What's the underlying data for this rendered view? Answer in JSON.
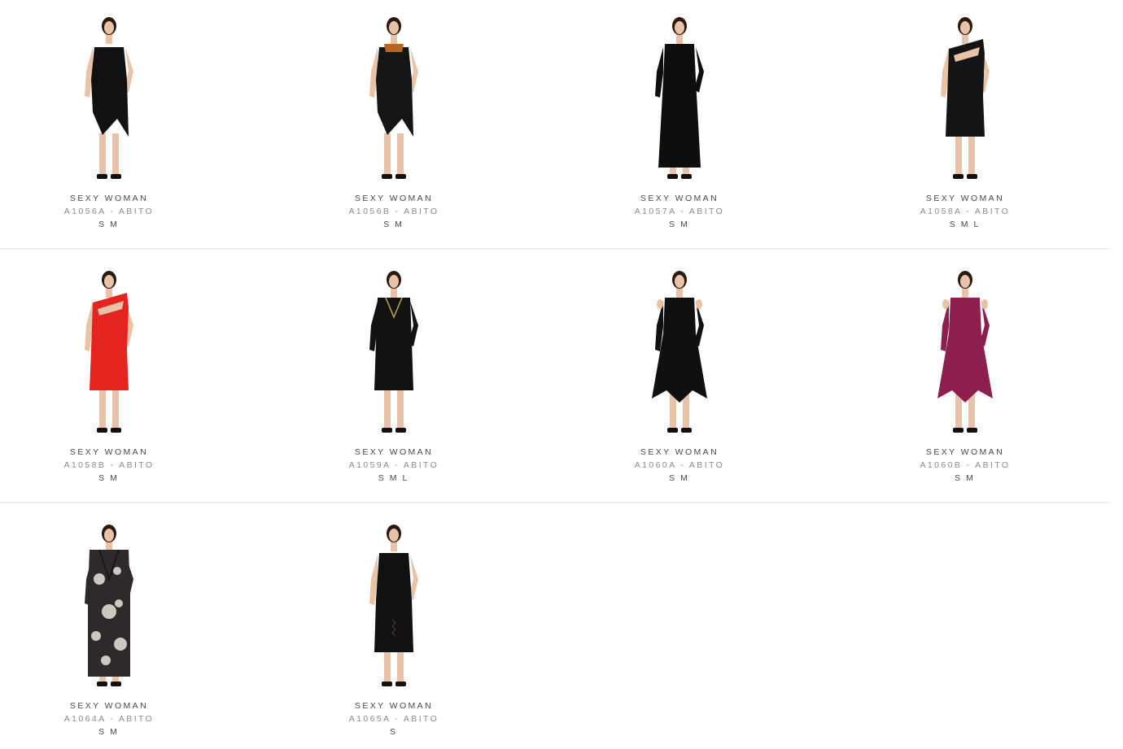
{
  "products": [
    {
      "brand": "SEXY WOMAN",
      "code": "A1056A - ABITO",
      "sizes": [
        "S",
        "M"
      ],
      "dress_color": "#111111",
      "accent": "#111111",
      "style": "asym-short"
    },
    {
      "brand": "SEXY WOMAN",
      "code": "A1056B - ABITO",
      "sizes": [
        "S",
        "M"
      ],
      "dress_color": "#151515",
      "accent": "#b8661f",
      "style": "asym-short"
    },
    {
      "brand": "SEXY WOMAN",
      "code": "A1057A - ABITO",
      "sizes": [
        "S",
        "M"
      ],
      "dress_color": "#0e0e0e",
      "accent": "#0e0e0e",
      "style": "long-sleeve-long"
    },
    {
      "brand": "SEXY WOMAN",
      "code": "A1058A - ABITO",
      "sizes": [
        "S",
        "M",
        "L"
      ],
      "dress_color": "#141414",
      "accent": "#141414",
      "style": "cutout-sheath"
    },
    {
      "brand": "SEXY WOMAN",
      "code": "A1058B - ABITO",
      "sizes": [
        "S",
        "M"
      ],
      "dress_color": "#e5231f",
      "accent": "#e5231f",
      "style": "cutout-sheath"
    },
    {
      "brand": "SEXY WOMAN",
      "code": "A1059A - ABITO",
      "sizes": [
        "S",
        "M",
        "L"
      ],
      "dress_color": "#121212",
      "accent": "#c9a24a",
      "style": "long-sleeve-short"
    },
    {
      "brand": "SEXY WOMAN",
      "code": "A1060A - ABITO",
      "sizes": [
        "S",
        "M"
      ],
      "dress_color": "#101010",
      "accent": "#101010",
      "style": "cold-shoulder"
    },
    {
      "brand": "SEXY WOMAN",
      "code": "A1060B - ABITO",
      "sizes": [
        "S",
        "M"
      ],
      "dress_color": "#8d1f4f",
      "accent": "#8d1f4f",
      "style": "cold-shoulder"
    },
    {
      "brand": "SEXY WOMAN",
      "code": "A1064A - ABITO",
      "sizes": [
        "S",
        "M"
      ],
      "dress_color": "#2e2a2c",
      "accent": "#e8e4dc",
      "style": "floral-wrap"
    },
    {
      "brand": "SEXY WOMAN",
      "code": "A1065A - ABITO",
      "sizes": [
        "S"
      ],
      "dress_color": "#111111",
      "accent": "#111111",
      "style": "sleeveless-short"
    }
  ]
}
